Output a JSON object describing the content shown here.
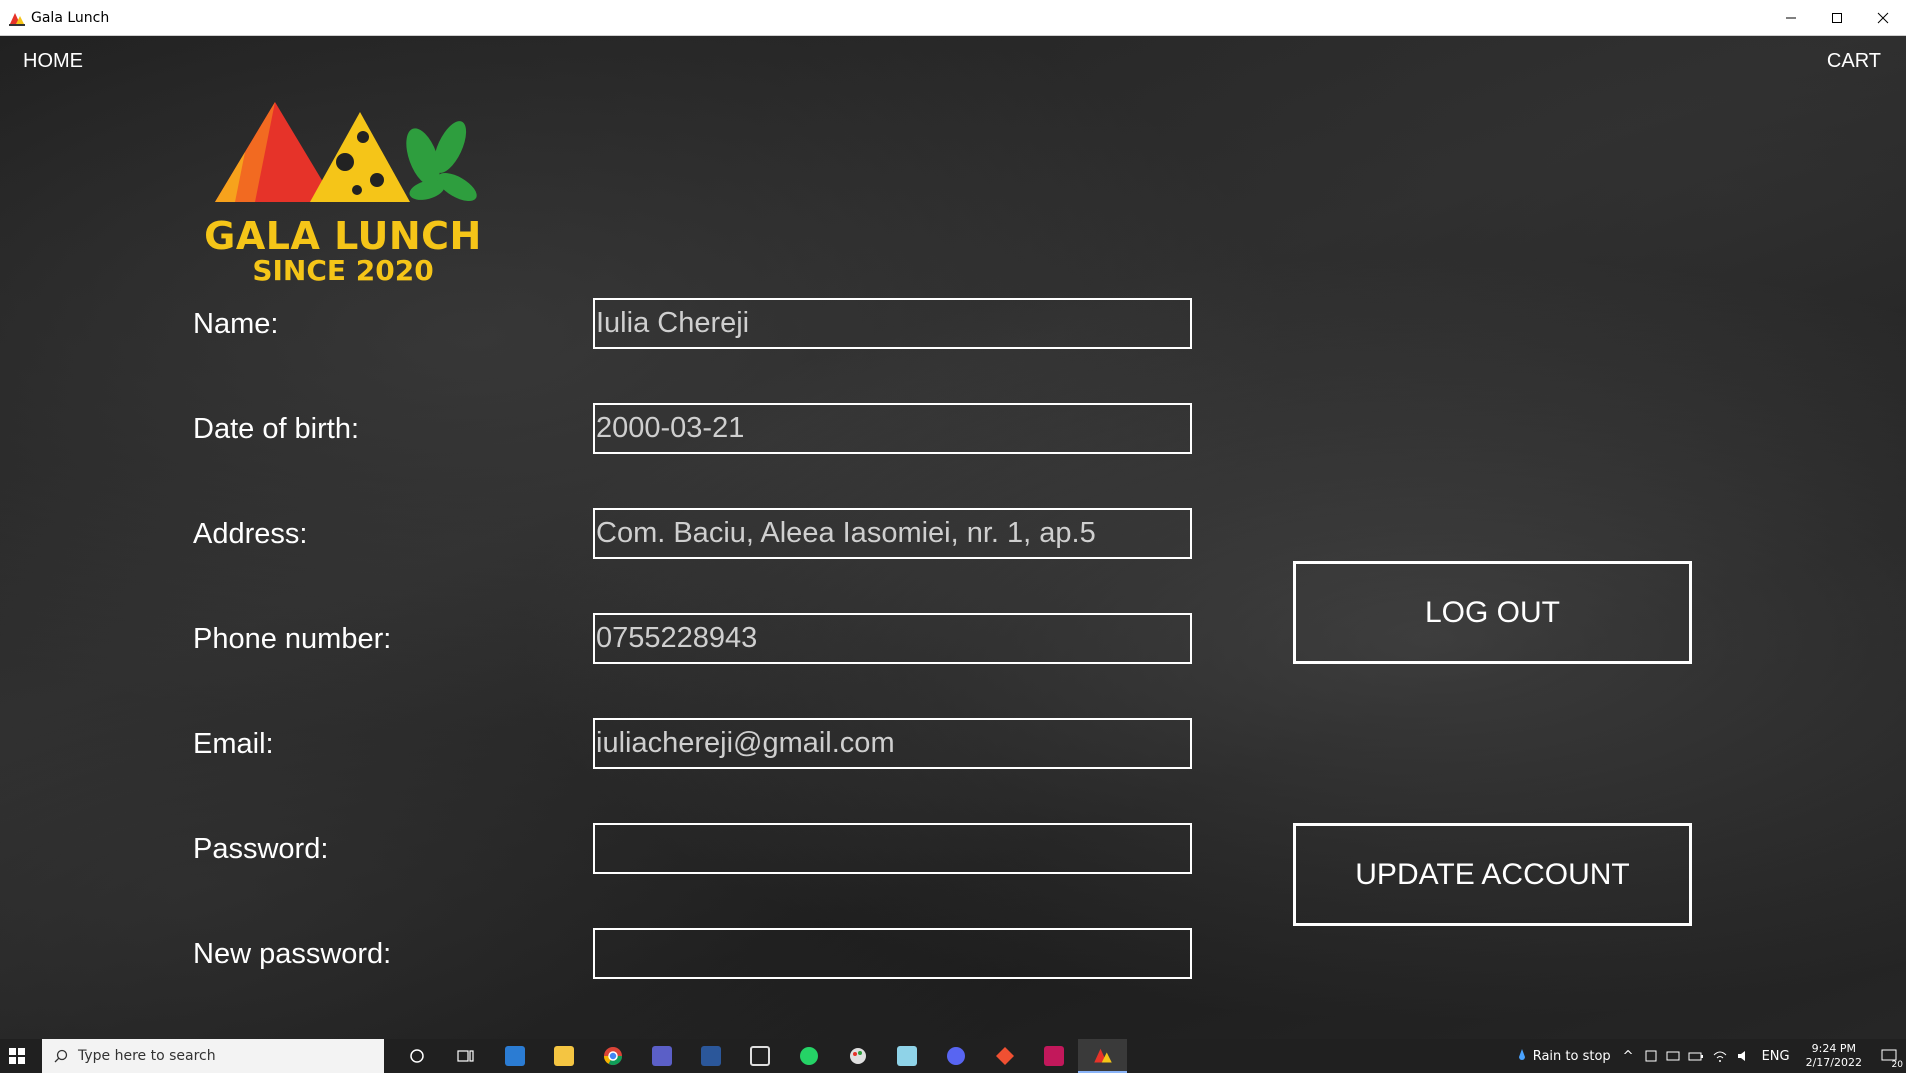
{
  "window": {
    "title": "Gala Lunch"
  },
  "nav": {
    "home": "HOME",
    "cart": "CART"
  },
  "logo": {
    "line1": "GALA LUNCH",
    "line2": "SINCE 2020"
  },
  "form": {
    "fields": [
      {
        "label": "Name:",
        "value": "Iulia Chereji"
      },
      {
        "label": "Date of birth:",
        "value": "2000-03-21"
      },
      {
        "label": "Address:",
        "value": "Com. Baciu, Aleea Iasomiei, nr. 1, ap.5"
      },
      {
        "label": "Phone number:",
        "value": "0755228943"
      },
      {
        "label": "Email:",
        "value": "iuliachereji@gmail.com"
      },
      {
        "label": "Password:",
        "value": ""
      },
      {
        "label": "New password:",
        "value": ""
      }
    ]
  },
  "buttons": {
    "logout": "LOG OUT",
    "update": "UPDATE ACCOUNT"
  },
  "taskbar": {
    "search_placeholder": "Type here to search",
    "weather": "Rain to stop",
    "language": "ENG",
    "time": "9:24 PM",
    "date": "2/17/2022",
    "notifications": "20"
  },
  "colors": {
    "brand_yellow": "#f5c518",
    "brand_red": "#e63329",
    "brand_green": "#2e9e3e",
    "background": "#222222"
  }
}
